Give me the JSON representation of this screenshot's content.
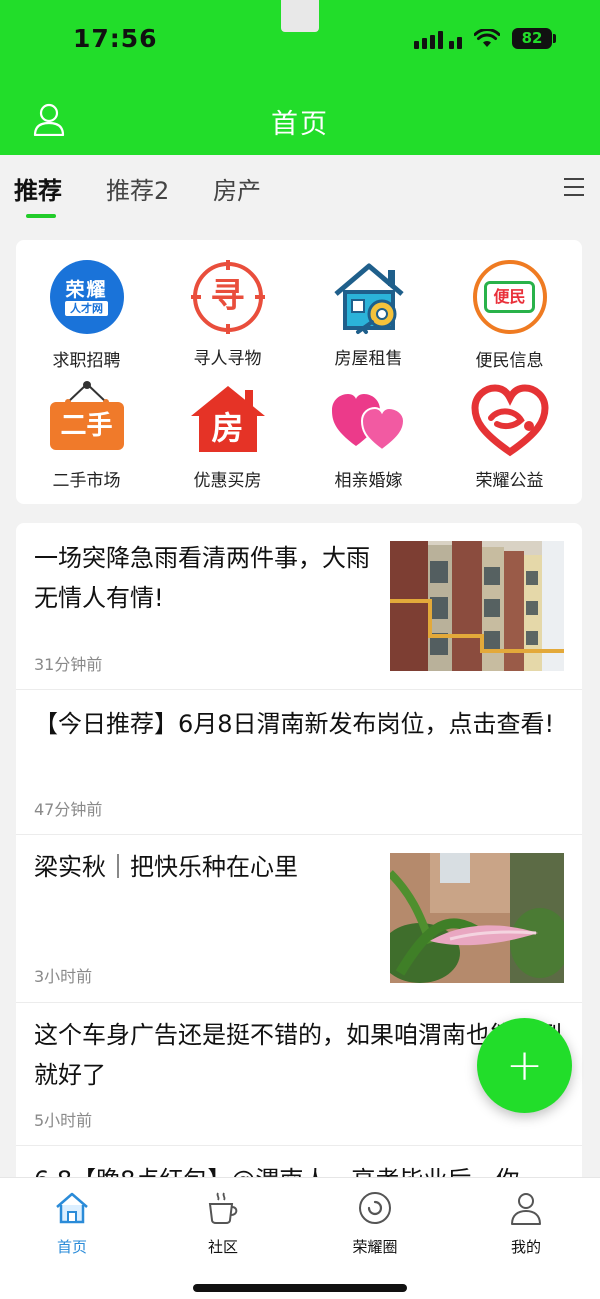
{
  "status": {
    "time": "17:56",
    "battery": "82"
  },
  "header": {
    "title": "首页"
  },
  "tabs": [
    {
      "label": "推荐",
      "active": true
    },
    {
      "label": "推荐2",
      "active": false
    },
    {
      "label": "房产",
      "active": false
    }
  ],
  "services": [
    {
      "label": "求职招聘",
      "icon": "job-icon",
      "badge_top": "荣耀",
      "badge_bottom": "人才网"
    },
    {
      "label": "寻人寻物",
      "icon": "search-person-icon",
      "glyph": "寻"
    },
    {
      "label": "房屋租售",
      "icon": "house-key-icon"
    },
    {
      "label": "便民信息",
      "icon": "convenience-icon",
      "glyph": "便民"
    },
    {
      "label": "二手市场",
      "icon": "secondhand-sign-icon",
      "glyph": "二手"
    },
    {
      "label": "优惠买房",
      "icon": "house-discount-icon",
      "glyph": "房"
    },
    {
      "label": "相亲婚嫁",
      "icon": "hearts-icon"
    },
    {
      "label": "荣耀公益",
      "icon": "charity-heart-icon"
    }
  ],
  "feed": [
    {
      "title": "一场突降急雨看清两件事，大雨无情人有情!",
      "time": "31分钟前",
      "thumb": "building-photo"
    },
    {
      "title": "【今日推荐】6月8日渭南新发布岗位，点击查看!",
      "time": "47分钟前"
    },
    {
      "title": "梁实秋｜把快乐种在心里",
      "time": "3小时前",
      "thumb": "lily-photo"
    },
    {
      "title": "这个车身广告还是挺不错的，如果咱渭南也能看到就好了",
      "time": "5小时前"
    },
    {
      "title": "6.8【晚8点红包】@渭南人，高考毕业后，你"
    }
  ],
  "fab": {
    "label": "+"
  },
  "bottom_nav": [
    {
      "label": "首页",
      "icon": "home-icon",
      "active": true
    },
    {
      "label": "社区",
      "icon": "coffee-cup-icon",
      "active": false
    },
    {
      "label": "荣耀圈",
      "icon": "circle-icon",
      "active": false
    },
    {
      "label": "我的",
      "icon": "profile-icon",
      "active": false
    }
  ],
  "colors": {
    "brand_green": "#22dd2a",
    "nav_active": "#2a8bd8"
  }
}
